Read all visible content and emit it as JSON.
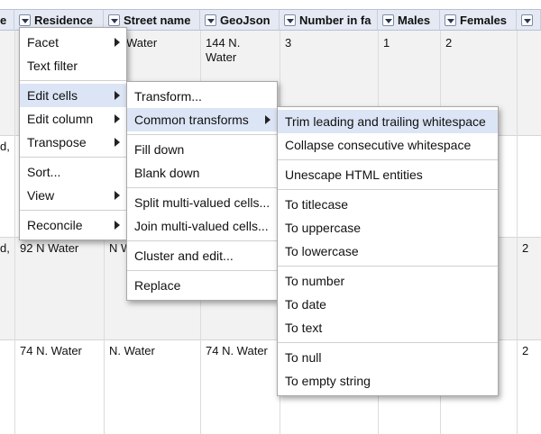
{
  "columns": [
    {
      "label": "e"
    },
    {
      "label": "Residence"
    },
    {
      "label": "Street name"
    },
    {
      "label": "GeoJson"
    },
    {
      "label": "Number in fa"
    },
    {
      "label": "Males"
    },
    {
      "label": "Females"
    },
    {
      "label": ""
    }
  ],
  "rows": [
    {
      "c0": "",
      "c1": "",
      "c2": "Water",
      "c3": "144 N.\nWater",
      "c4": "3",
      "c5": "1",
      "c6": "2",
      "c7": ""
    },
    {
      "c0": "d,",
      "c1": "",
      "c2": "",
      "c3": "",
      "c4": "",
      "c5": "",
      "c6": "",
      "c7": ""
    },
    {
      "c0": "d,",
      "c1": "92 N Water",
      "c2": "N W",
      "c3": "",
      "c4": "",
      "c5": "",
      "c6": "",
      "c7": "2"
    },
    {
      "c0": "",
      "c1": "74 N. Water",
      "c2": "N. Water",
      "c3": "74 N. Water",
      "c4": "",
      "c5": "",
      "c6": "",
      "c7": "2"
    }
  ],
  "menu1": {
    "facet": "Facet",
    "text_filter": "Text filter",
    "edit_cells": "Edit cells",
    "edit_column": "Edit column",
    "transpose": "Transpose",
    "sort": "Sort...",
    "view": "View",
    "reconcile": "Reconcile"
  },
  "menu2": {
    "transform": "Transform...",
    "common_transforms": "Common transforms",
    "fill_down": "Fill down",
    "blank_down": "Blank down",
    "split": "Split multi-valued cells...",
    "join": "Join multi-valued cells...",
    "cluster": "Cluster and edit...",
    "replace": "Replace"
  },
  "menu3": {
    "trim": "Trim leading and trailing whitespace",
    "collapse": "Collapse consecutive whitespace",
    "unescape": "Unescape HTML entities",
    "titlecase": "To titlecase",
    "uppercase": "To uppercase",
    "lowercase": "To lowercase",
    "number": "To number",
    "date": "To date",
    "text": "To text",
    "null": "To null",
    "empty": "To empty string"
  }
}
